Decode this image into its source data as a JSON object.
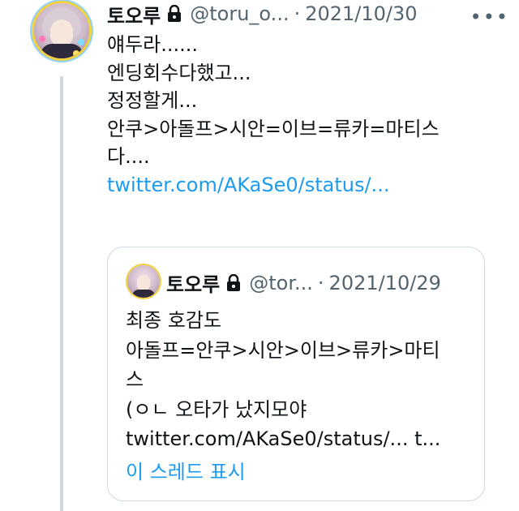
{
  "tweet": {
    "author_name": "토오루",
    "handle": "@toru_o...",
    "separator": "·",
    "date": "2021/10/30",
    "more_label": "•••",
    "text_lines": [
      "얘두라......",
      "엔딩회수다했고...",
      "정정할게...",
      "안쿠>아돌프>시안=이브=류카=마티스",
      "다....",
      ""
    ],
    "link": "twitter.com/AKaSe0/status/..."
  },
  "quote": {
    "author_name": "토오루",
    "handle": "@tor...",
    "separator": "·",
    "date": "2021/10/29",
    "text_lines": [
      "최종 호감도",
      "아돌프=안쿠>시안>이브>류카>마티",
      "스",
      "(ㅇㄴ 오타가 났지모야",
      "twitter.com/AKaSe0/status/... t..."
    ],
    "show_thread": "이 스레드 표시"
  },
  "colors": {
    "link": "#1d9bf0",
    "secondary_text": "#536471",
    "border": "#cfd9de"
  },
  "icons": [
    "lock-icon",
    "more-icon",
    "avatar"
  ]
}
